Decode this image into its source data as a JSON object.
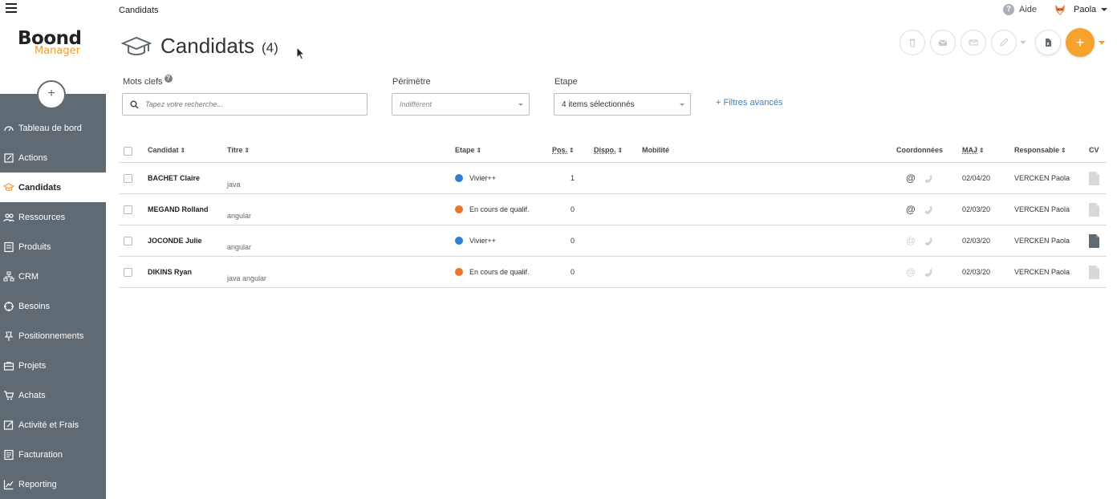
{
  "app": {
    "logo_main": "Boond",
    "logo_sub": "Manager"
  },
  "header": {
    "breadcrumb": "Candidats",
    "help_label": "Aide",
    "user_name": "Paola"
  },
  "page": {
    "title": "Candidats",
    "count": "(4)"
  },
  "sidebar": {
    "items": [
      {
        "label": "Tableau de bord",
        "icon": "dashboard-icon"
      },
      {
        "label": "Actions",
        "icon": "actions-icon"
      },
      {
        "label": "Candidats",
        "icon": "graduation-cap-icon",
        "active": true
      },
      {
        "label": "Ressources",
        "icon": "users-icon"
      },
      {
        "label": "Produits",
        "icon": "product-icon"
      },
      {
        "label": "CRM",
        "icon": "crm-icon"
      },
      {
        "label": "Besoins",
        "icon": "target-icon"
      },
      {
        "label": "Positionnements",
        "icon": "pin-icon"
      },
      {
        "label": "Projets",
        "icon": "briefcase-icon"
      },
      {
        "label": "Achats",
        "icon": "cart-icon"
      },
      {
        "label": "Activité et Frais",
        "icon": "edit-icon"
      },
      {
        "label": "Facturation",
        "icon": "invoice-icon"
      },
      {
        "label": "Reporting",
        "icon": "chart-icon"
      }
    ]
  },
  "filters": {
    "keywords_label": "Mots clefs",
    "search_placeholder": "Tapez votre recherche...",
    "perimetre_label": "Périmètre",
    "perimetre_value": "Indifférent",
    "etape_label": "Etape",
    "etape_value": "4 items sélectionnés",
    "advanced_link": "+ Filtres avancés"
  },
  "table": {
    "columns": {
      "candidat": "Candidat",
      "titre": "Titre",
      "etape": "Etape",
      "pos": "Pos.",
      "dispo": "Dispo.",
      "mobilite": "Mobilité",
      "coordonnees": "Coordonnées",
      "maj": "MAJ",
      "responsable": "Responsable",
      "cv": "CV"
    },
    "rows": [
      {
        "name": "BACHET Claire",
        "titre": "java",
        "etape": "Vivier++",
        "etape_color": "#2f7fd0",
        "pos": "1",
        "email": true,
        "maj": "02/04/20",
        "responsable": "VERCKEN Paola",
        "cv": false
      },
      {
        "name": "MEGAND Rolland",
        "titre": "angular",
        "etape": "En cours de qualif.",
        "etape_color": "#e8762c",
        "pos": "0",
        "email": true,
        "maj": "02/03/20",
        "responsable": "VERCKEN Paola",
        "cv": false
      },
      {
        "name": "JOCONDE Julie",
        "titre": "angular",
        "etape": "Vivier++",
        "etape_color": "#2f7fd0",
        "pos": "0",
        "email": false,
        "maj": "02/03/20",
        "responsable": "VERCKEN Paola",
        "cv": true
      },
      {
        "name": "DIKINS Ryan",
        "titre": "java angular",
        "etape": "En cours de qualif.",
        "etape_color": "#e8762c",
        "pos": "0",
        "email": false,
        "maj": "02/03/20",
        "responsable": "VERCKEN Paola",
        "cv": false
      }
    ]
  },
  "colors": {
    "accent": "#f5a32c",
    "sidebar": "#5f6a72",
    "link": "#3b82c4"
  }
}
